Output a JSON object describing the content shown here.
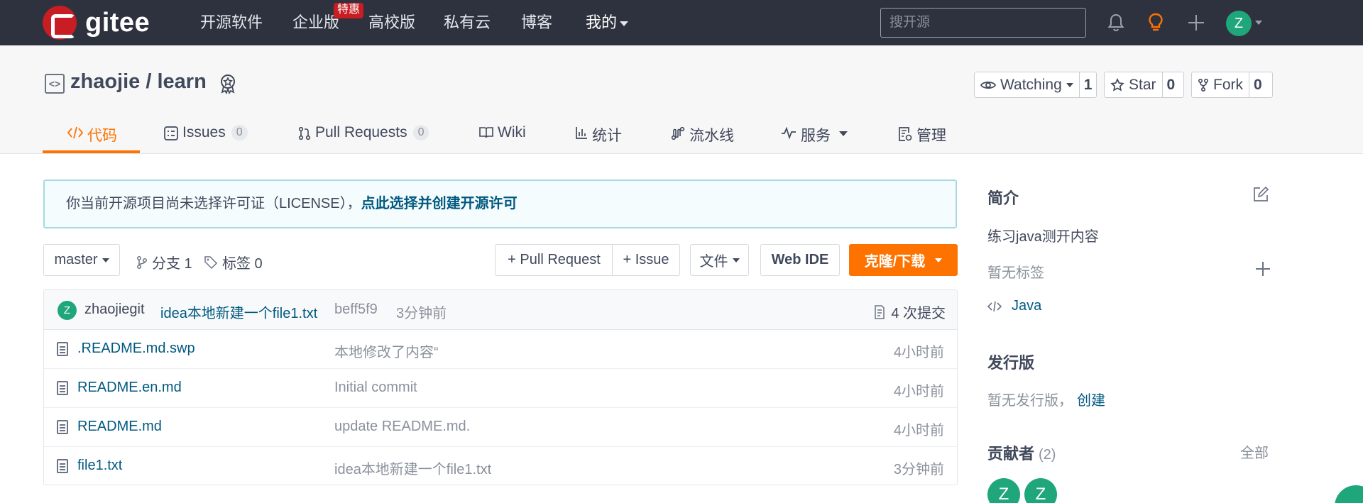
{
  "topnav": {
    "logo_text": "gitee",
    "items": [
      {
        "label": "开源软件"
      },
      {
        "label": "企业版"
      },
      {
        "label": "高校版"
      },
      {
        "label": "私有云"
      },
      {
        "label": "博客"
      },
      {
        "label": "我的"
      }
    ],
    "badge": "特惠",
    "search_placeholder": "搜开源",
    "avatar_letter": "Z"
  },
  "repo": {
    "title": "zhaojie / learn",
    "watch_label": "Watching",
    "watch_count": "1",
    "star_label": "Star",
    "star_count": "0",
    "fork_label": "Fork",
    "fork_count": "0"
  },
  "tabs": [
    {
      "label": "代码",
      "icon": "code-icon"
    },
    {
      "label": "Issues",
      "count": "0",
      "icon": "issues-icon"
    },
    {
      "label": "Pull Requests",
      "count": "0",
      "icon": "pull-request-icon"
    },
    {
      "label": "Wiki",
      "icon": "wiki-icon"
    },
    {
      "label": "统计",
      "icon": "stats-icon"
    },
    {
      "label": "流水线",
      "icon": "pipeline-icon"
    },
    {
      "label": "服务",
      "icon": "service-icon"
    },
    {
      "label": "管理",
      "icon": "manage-icon"
    }
  ],
  "notice": {
    "text": "你当前开源项目尚未选择许可证（LICENSE），",
    "link": "点此选择并创建开源许可"
  },
  "toolbar": {
    "branch": "master",
    "branches": "分支 1",
    "tags": "标签 0",
    "pull_request": "+ Pull Request",
    "issue": "+ Issue",
    "file": "文件",
    "web_ide": "Web IDE",
    "clone": "克隆/下载"
  },
  "commit": {
    "avatar_letter": "Z",
    "author": "zhaojiegit",
    "message": "idea本地新建一个file1.txt",
    "hash": "beff5f9",
    "time": "3分钟前",
    "count": "4 次提交"
  },
  "files": [
    {
      "name": ".README.md.swp",
      "message": "本地修改了内容“",
      "time": "4小时前"
    },
    {
      "name": "README.en.md",
      "message": "Initial commit",
      "time": "4小时前"
    },
    {
      "name": "README.md",
      "message": "update README.md.",
      "time": "4小时前"
    },
    {
      "name": "file1.txt",
      "message": "idea本地新建一个file1.txt",
      "time": "3分钟前"
    }
  ],
  "sidebar": {
    "intro_title": "简介",
    "intro_text": "练习java测开内容",
    "no_tags": "暂无标签",
    "language": "Java",
    "release_title": "发行版",
    "no_release": "暂无发行版，",
    "create": "创建",
    "contrib_title": "贡献者",
    "contrib_count": "(2)",
    "all": "全部",
    "contributors": [
      "Z",
      "Z"
    ]
  },
  "colors": {
    "nav_bg": "#2e323e",
    "accent": "#fe7300",
    "link": "#005980",
    "avatar": "#1fa67a"
  }
}
